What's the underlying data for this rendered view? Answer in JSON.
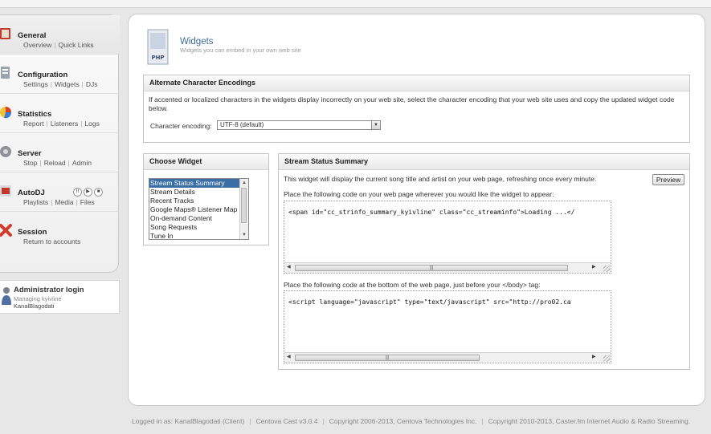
{
  "nav": [
    {
      "title": "General",
      "icon": "general-icon",
      "links": [
        "Overview",
        "Quick Links"
      ]
    },
    {
      "title": "Configuration",
      "icon": "configuration-icon",
      "links": [
        "Settings",
        "Widgets",
        "DJs"
      ]
    },
    {
      "title": "Statistics",
      "icon": "statistics-icon",
      "links": [
        "Report",
        "Listeners",
        "Logs"
      ]
    },
    {
      "title": "Server",
      "icon": "server-icon",
      "links": [
        "Stop",
        "Reload",
        "Admin"
      ]
    },
    {
      "title": "AutoDJ",
      "icon": "autodj-icon",
      "links": [
        "Playlists",
        "Media",
        "Files"
      ],
      "controls": [
        "II",
        "▶",
        "■"
      ]
    },
    {
      "title": "Session",
      "icon": "session-icon",
      "links": [
        "Return to accounts"
      ]
    }
  ],
  "admin": {
    "title": "Administrator login",
    "subtitle": "Managing kyivline",
    "user": "KanalBlagodati"
  },
  "page": {
    "title": "Widgets",
    "subtitle": "Widgets you can embed in your own web site",
    "icon_label": "PHP"
  },
  "encoding": {
    "heading": "Alternate Character Encodings",
    "description": "If accented or localized characters in the widgets display incorrectly on your web site, select the character encoding that your web site uses and copy the updated widget code below.",
    "label": "Character encoding:",
    "selected": "UTF-8 (default)"
  },
  "widgets": {
    "heading": "Choose Widget",
    "items": [
      "Stream Status Summary",
      "Stream Details",
      "Recent Tracks",
      "Google Maps® Listener Map",
      "On-demand Content",
      "Song Requests",
      "Tune In"
    ],
    "selected_index": 0
  },
  "summary": {
    "heading": "Stream Status Summary",
    "description": "This widget will display the current song title and artist on your web page, refreshing once every minute.",
    "preview_label": "Preview",
    "code1_label": "Place the following code on your web page wherever you would like the widget to appear:",
    "code1": "<span id=\"cc_strinfo_summary_kyivline\" class=\"cc_streaminfo\">Loading ...</",
    "code2_label": "Place the following code at the bottom of the web page, just before your </body> tag:",
    "code2": "<script language=\"javascript\" type=\"text/javascript\" src=\"http://pro02.ca"
  },
  "footer": {
    "logged_in": "Logged in as: KanalBlagodati (Client)",
    "version": "Centova Cast v3.0.4",
    "copyright1": "Copyright 2006-2013, Centova Technologies Inc.",
    "copyright2": "Copyright 2010-2013, Caster.fm Internet Audio & Radio Streaming."
  },
  "colors": {
    "accent": "#3d6a9c",
    "selection": "#3a6ea5"
  }
}
